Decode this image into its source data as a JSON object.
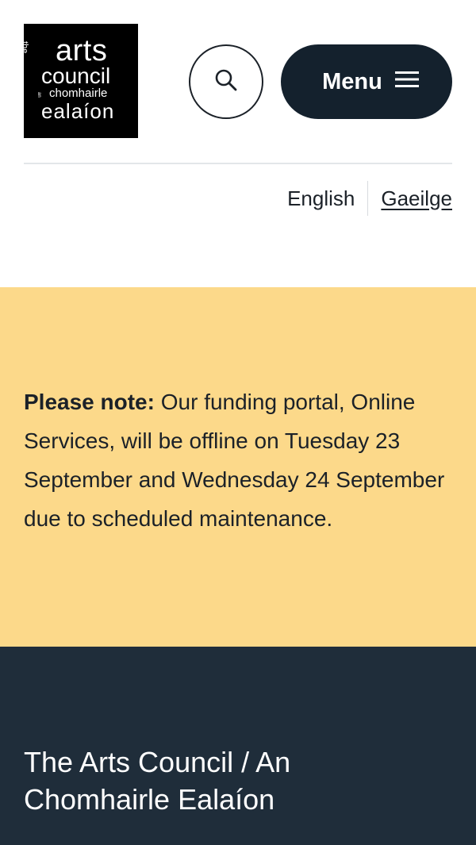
{
  "header": {
    "logo": {
      "the": "the",
      "arts": "arts",
      "council": "council",
      "an": "an",
      "chomhairle": "chomhairle",
      "ealaion": "ealaíon"
    },
    "search_icon": "search-icon",
    "menu_label": "Menu",
    "menu_icon": "hamburger-icon"
  },
  "language": {
    "current": "English",
    "alternate": "Gaeilge"
  },
  "notice": {
    "label": "Please note:",
    "message": "Our funding portal, Online Services, will be offline on Tuesday 23 September and Wednesday 24 September due to scheduled maintenance."
  },
  "section": {
    "title": "The Arts Council / An Chomhairle Ealaíon"
  },
  "colors": {
    "notice_bg": "#fcd98a",
    "dark_bg": "#1f2d3a",
    "menu_bg": "#14212d"
  }
}
